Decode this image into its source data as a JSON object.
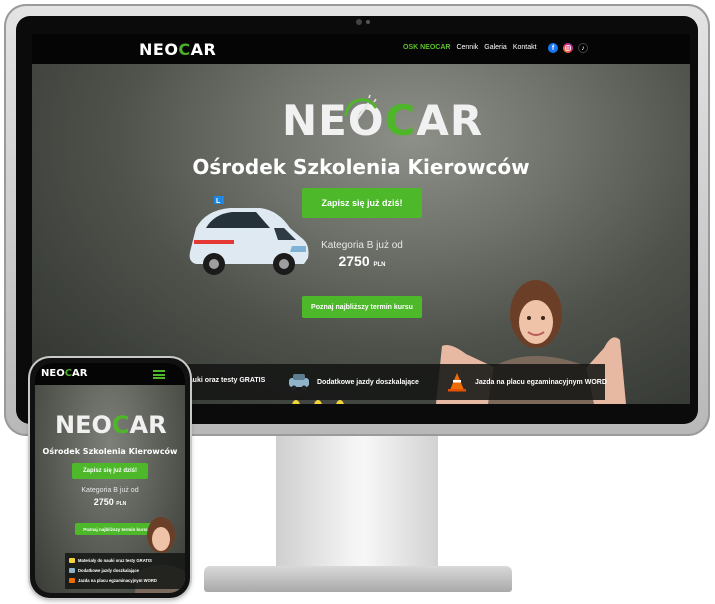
{
  "desktop": {
    "nav": {
      "logo": {
        "part1": "NEO",
        "part2": "C",
        "part3": "AR"
      },
      "menu": [
        "OSK NEOCAR",
        "Cennik",
        "Galeria",
        "Kontakt"
      ],
      "social_icons": [
        "facebook-icon",
        "instagram-icon",
        "tiktok-icon"
      ]
    },
    "hero": {
      "logo": {
        "part1": "NEO",
        "part2": "C",
        "part3": "AR"
      },
      "title": "Ośrodek Szkolenia Kierowców",
      "signup_button": "Zapisz się już dziś!",
      "category_text": "Kategoria B już od",
      "price": "2750",
      "currency": "PLN",
      "term_button": "Poznaj najbliższy termin kursu"
    },
    "features": [
      {
        "text": "do nauki oraz testy GRATIS",
        "icon": "book-icon"
      },
      {
        "text": "Dodatkowe jazdy doszkalające",
        "icon": "car-icon"
      },
      {
        "text": "Jazda na placu egzaminacyjnym WORD",
        "icon": "traffic-cone-icon"
      }
    ]
  },
  "mobile": {
    "nav": {
      "logo": {
        "part1": "NEO",
        "part2": "C",
        "part3": "AR"
      },
      "menu_icon": "hamburger-menu-icon"
    },
    "hero": {
      "logo": {
        "part1": "NEO",
        "part2": "C",
        "part3": "AR"
      },
      "title": "Ośrodek Szkolenia Kierowców",
      "signup_button": "Zapisz się już dziś!",
      "category_text": "Kategoria B już od",
      "price": "2750",
      "currency": "PLN",
      "term_button": "Poznaj najbliższy termin kursu"
    },
    "features": [
      "Materiały do nauki oraz testy GRATIS",
      "Dodatkowe jazdy doszkalające",
      "Jazda na placu egzaminacyjnym WORD"
    ]
  },
  "colors": {
    "brand_green": "#4cb82a",
    "nav_black": "#050505",
    "active_menu": "#59c22b"
  }
}
